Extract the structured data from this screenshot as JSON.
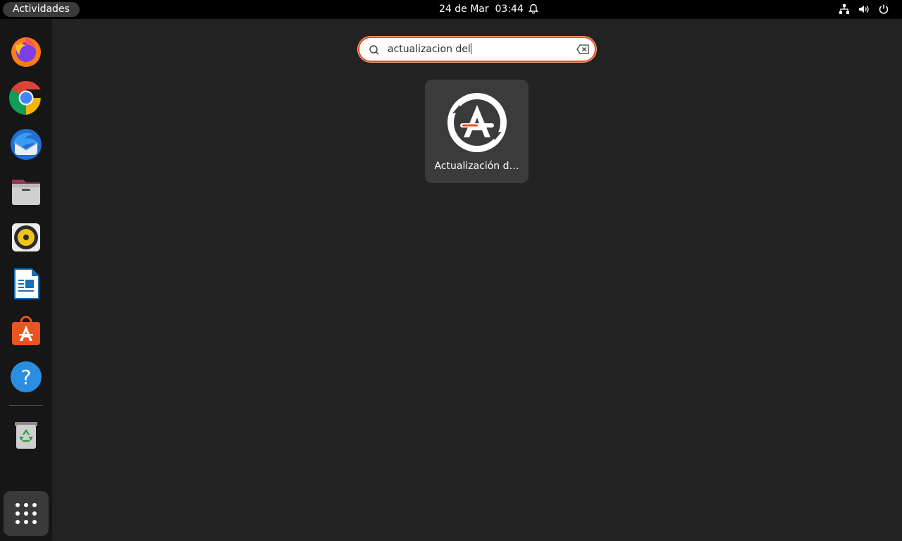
{
  "topbar": {
    "activities_label": "Actividades",
    "clock": "24 de Mar  03:44",
    "tray": [
      "network-icon",
      "volume-icon",
      "power-icon"
    ]
  },
  "dock": {
    "items": [
      {
        "name": "firefox",
        "icon": "firefox-icon"
      },
      {
        "name": "chrome",
        "icon": "chrome-icon"
      },
      {
        "name": "thunderbird",
        "icon": "thunderbird-icon"
      },
      {
        "name": "files",
        "icon": "files-icon"
      },
      {
        "name": "rhythmbox",
        "icon": "rhythmbox-icon"
      },
      {
        "name": "writer",
        "icon": "writer-icon"
      },
      {
        "name": "software",
        "icon": "software-icon"
      },
      {
        "name": "help",
        "icon": "help-icon"
      },
      {
        "name": "trash",
        "icon": "trash-icon"
      }
    ],
    "app_grid": "app-grid-icon"
  },
  "search": {
    "value": "actualizacion del",
    "placeholder": ""
  },
  "results": [
    {
      "label": "Actualización d…",
      "icon": "software-updater-icon"
    }
  ],
  "colors": {
    "accent": "#e95420",
    "topbar": "#000000",
    "dock": "#161616",
    "background": "#222222",
    "tile": "#3b3b3b"
  }
}
